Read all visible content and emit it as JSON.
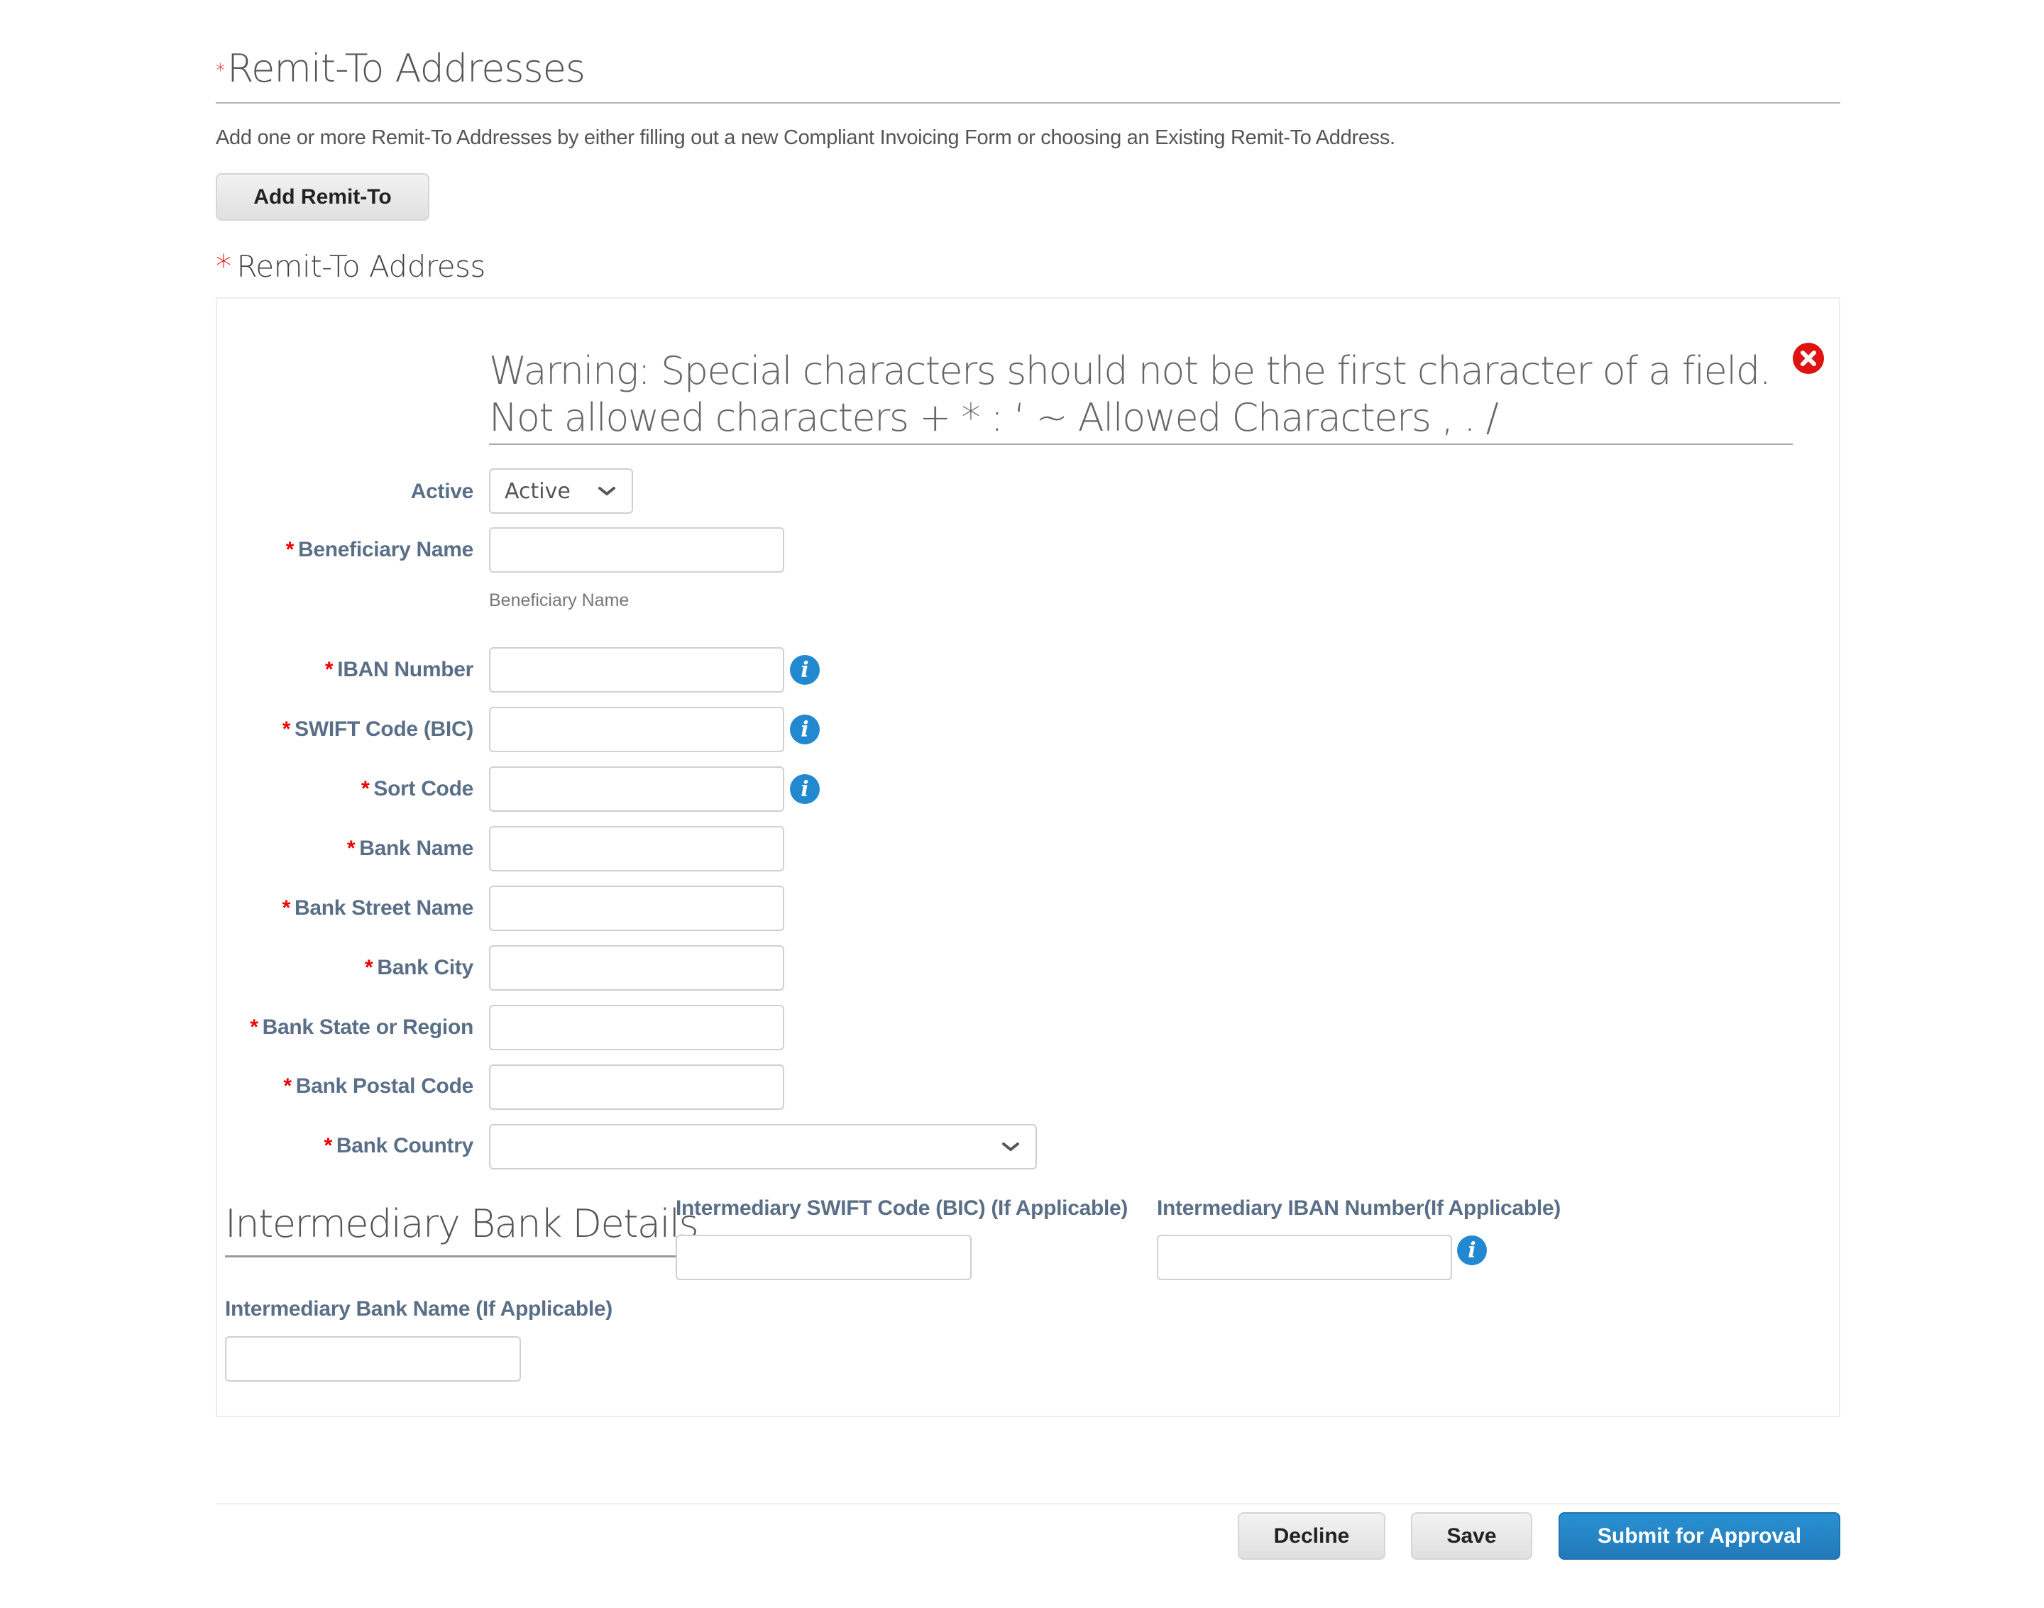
{
  "header": {
    "required_marker": "*",
    "title": "Remit-To Addresses",
    "description": "Add one or more Remit-To Addresses by either filling out a new Compliant Invoicing Form or choosing an Existing Remit-To Address.",
    "add_button": "Add Remit-To"
  },
  "remit_section": {
    "required_marker": "*",
    "title": "Remit-To Address",
    "warning": "Warning: Special characters should not be the first character of a field. Not allowed characters + * : ‘ ~ Allowed Characters , . /",
    "close_icon": "close-circle-icon"
  },
  "form": {
    "active": {
      "label": "Active",
      "value": "Active"
    },
    "fields": [
      {
        "label": "Beneficiary Name",
        "required": "*",
        "value": "",
        "helper": "Beneficiary Name",
        "info": false
      },
      {
        "label": "IBAN Number",
        "required": "*",
        "value": "",
        "info": true
      },
      {
        "label": "SWIFT Code (BIC)",
        "required": "*",
        "value": "",
        "info": true
      },
      {
        "label": "Sort Code",
        "required": "*",
        "value": "",
        "info": true
      },
      {
        "label": "Bank Name",
        "required": "*",
        "value": "",
        "info": false
      },
      {
        "label": "Bank Street Name",
        "required": "*",
        "value": "",
        "info": false
      },
      {
        "label": "Bank City",
        "required": "*",
        "value": "",
        "info": false
      },
      {
        "label": "Bank State or Region",
        "required": "*",
        "value": "",
        "info": false
      },
      {
        "label": "Bank Postal Code",
        "required": "*",
        "value": "",
        "info": false
      }
    ],
    "bank_country": {
      "label": "Bank Country",
      "required": "*",
      "value": ""
    },
    "info_icon_glyph": "i"
  },
  "intermediary": {
    "title": "Intermediary Bank Details",
    "swift_label": "Intermediary SWIFT Code (BIC) (If Applicable)",
    "swift_value": "",
    "iban_label": "Intermediary IBAN Number(If Applicable)",
    "iban_value": "",
    "bank_name_label": "Intermediary Bank Name (If Applicable)",
    "bank_name_value": ""
  },
  "footer": {
    "decline": "Decline",
    "save": "Save",
    "submit": "Submit for Approval"
  },
  "colors": {
    "primary": "#2584c6",
    "required": "#e00000",
    "label": "#5a6f87",
    "close": "#e01212"
  }
}
